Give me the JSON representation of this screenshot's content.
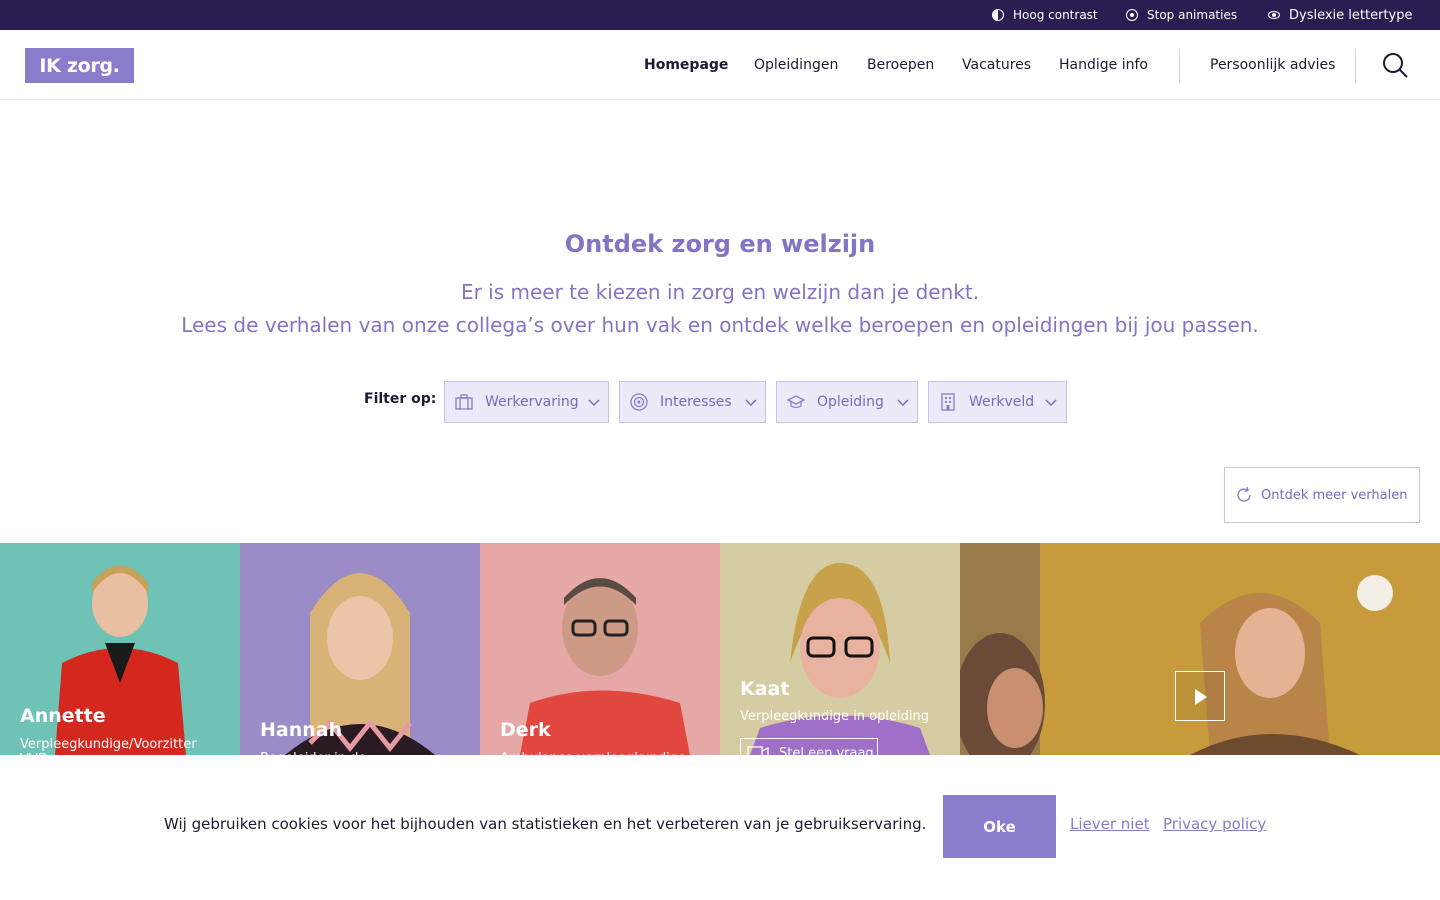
{
  "topbar": {
    "items": [
      {
        "label": "Hoog contrast",
        "icon": "contrast-icon"
      },
      {
        "label": "Stop animaties",
        "icon": "stop-animation-icon"
      },
      {
        "label": "Dyslexie lettertype",
        "icon": "eye-icon"
      }
    ]
  },
  "header": {
    "logo_text": "IK zorg.",
    "nav": [
      {
        "label": "Homepage",
        "active": true
      },
      {
        "label": "Opleidingen"
      },
      {
        "label": "Beroepen"
      },
      {
        "label": "Vacatures"
      },
      {
        "label": "Handige info"
      }
    ],
    "advice_label": "Persoonlijk advies",
    "search_icon": "search-icon"
  },
  "hero": {
    "title": "Ontdek zorg en welzijn",
    "subtitle_line1": "Er is meer te kiezen in zorg en welzijn dan je denkt.",
    "subtitle_line2": "Lees de verhalen van onze collega’s over hun vak en ontdek welke beroepen en opleidingen bij jou passen."
  },
  "filters": {
    "label": "Filter op:",
    "items": [
      {
        "label": "Werkervaring",
        "icon": "briefcase-icon"
      },
      {
        "label": "Interesses",
        "icon": "target-icon"
      },
      {
        "label": "Opleiding",
        "icon": "graduation-cap-icon"
      },
      {
        "label": "Werkveld",
        "icon": "building-icon"
      }
    ]
  },
  "more_stories_label": "Ontdek meer verhalen",
  "stories": [
    {
      "name": "Annette",
      "role": "Verpleegkundige/Voorzitter VVD"
    },
    {
      "name": "Hannah",
      "role": "Begeleider in de..."
    },
    {
      "name": "Derk",
      "role": "Ambulance verpleegkundige"
    },
    {
      "name": "Kaat",
      "role": "Verpleegkundige in opleiding",
      "ask_label": "Stel een vraag"
    }
  ],
  "cookie": {
    "text": "Wij gebruiken cookies voor het bijhouden van statistieken en het verbeteren van je gebruikservaring.",
    "accept_label": "Oke",
    "decline_label": "Liever niet",
    "privacy_label": "Privacy policy"
  },
  "colors": {
    "topbar": "#2b1d52",
    "brand": "#8b7bcb",
    "brand_text": "#8573c5",
    "filter_bg": "#ece9f8"
  }
}
